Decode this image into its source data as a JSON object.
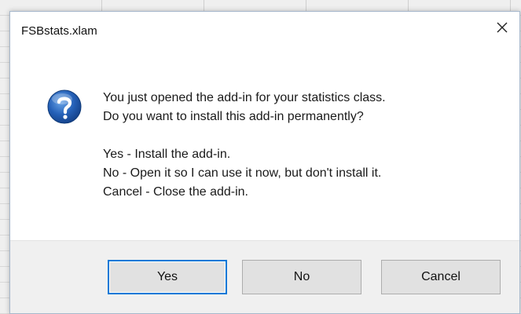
{
  "dialog": {
    "title": "FSBstats.xlam",
    "close_icon": "close-icon",
    "question_icon": "question-icon",
    "message_lines": [
      "You just opened the add-in for your statistics class.",
      "Do you  want to install this add-in permanently?"
    ],
    "option_lines": [
      "Yes - Install the add-in.",
      "No - Open it so I can use it now, but don't install it.",
      "Cancel - Close the add-in."
    ],
    "buttons": {
      "yes": "Yes",
      "no": "No",
      "cancel": "Cancel"
    }
  },
  "colors": {
    "accent": "#0078d7",
    "icon_blue": "#1f5fae",
    "footer_bg": "#f0f0f0"
  }
}
